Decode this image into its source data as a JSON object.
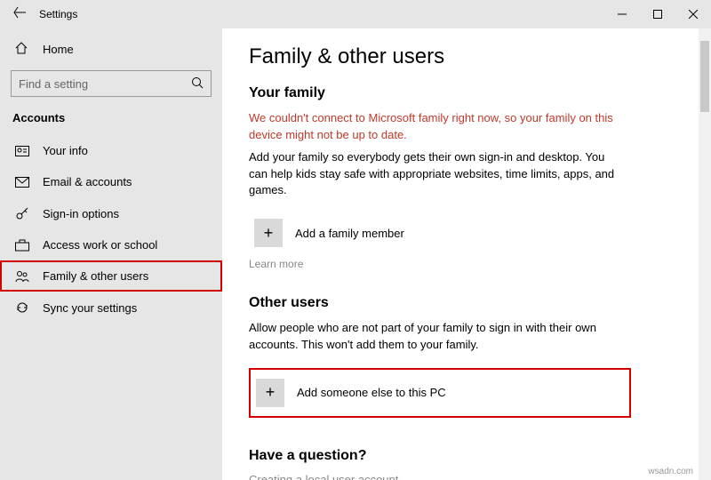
{
  "window": {
    "title": "Settings"
  },
  "sidebar": {
    "home_label": "Home",
    "search_placeholder": "Find a setting",
    "category": "Accounts",
    "items": [
      {
        "label": "Your info",
        "icon": "person-card-icon"
      },
      {
        "label": "Email & accounts",
        "icon": "mail-icon"
      },
      {
        "label": "Sign-in options",
        "icon": "key-icon"
      },
      {
        "label": "Access work or school",
        "icon": "briefcase-icon"
      },
      {
        "label": "Family & other users",
        "icon": "people-icon"
      },
      {
        "label": "Sync your settings",
        "icon": "sync-icon"
      }
    ]
  },
  "main": {
    "title": "Family & other users",
    "family": {
      "heading": "Your family",
      "error": "We couldn't connect to Microsoft family right now, so your family on this device might not be up to date.",
      "desc": "Add your family so everybody gets their own sign-in and desktop. You can help kids stay safe with appropriate websites, time limits, apps, and games.",
      "add_label": "Add a family member",
      "learn_more": "Learn more"
    },
    "other": {
      "heading": "Other users",
      "desc": "Allow people who are not part of your family to sign in with their own accounts. This won't add them to your family.",
      "add_label": "Add someone else to this PC"
    },
    "question": {
      "heading": "Have a question?",
      "sub": "Creating a local user account"
    }
  },
  "footer": {
    "watermark": "wsadn.com"
  }
}
